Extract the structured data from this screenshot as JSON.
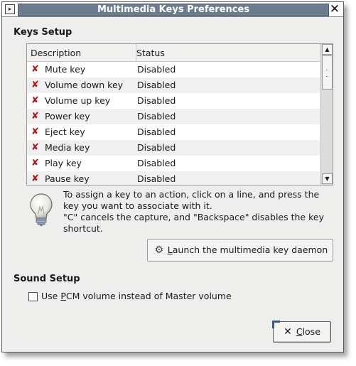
{
  "window": {
    "title": "Multimedia Keys Preferences",
    "menu_glyph": "▸",
    "close_glyph": "✕"
  },
  "keys_setup": {
    "title": "Keys Setup",
    "columns": [
      "Description",
      "Status"
    ],
    "rows": [
      {
        "description": "Mute key",
        "status": "Disabled"
      },
      {
        "description": "Volume down key",
        "status": "Disabled"
      },
      {
        "description": "Volume up key",
        "status": "Disabled"
      },
      {
        "description": "Power key",
        "status": "Disabled"
      },
      {
        "description": "Eject key",
        "status": "Disabled"
      },
      {
        "description": "Media key",
        "status": "Disabled"
      },
      {
        "description": "Play key",
        "status": "Disabled"
      },
      {
        "description": "Pause key",
        "status": "Disabled"
      }
    ],
    "row_icon": "x-mark-icon",
    "scroll_up_glyph": "▲",
    "scroll_down_glyph": "▼"
  },
  "info": {
    "line1": "To assign a key to an action, click on a line, and press the key you want to associate with it.",
    "line2": "\"C\" cancels the capture, and \"Backspace\" disables the key shortcut."
  },
  "daemon_button": {
    "label_prefix": "",
    "mnemonic": "L",
    "label_rest": "aunch the multimedia key daemon"
  },
  "sound_setup": {
    "title": "Sound Setup",
    "checkbox_prefix": "Use ",
    "checkbox_mnemonic": "P",
    "checkbox_rest": "CM volume instead of Master volume",
    "checked": false
  },
  "close_button": {
    "mnemonic": "C",
    "label_rest": "lose"
  },
  "colors": {
    "title_bar": "#6c7c8e",
    "x_mark": "#b01818",
    "window_bg": "#eeeeec"
  }
}
